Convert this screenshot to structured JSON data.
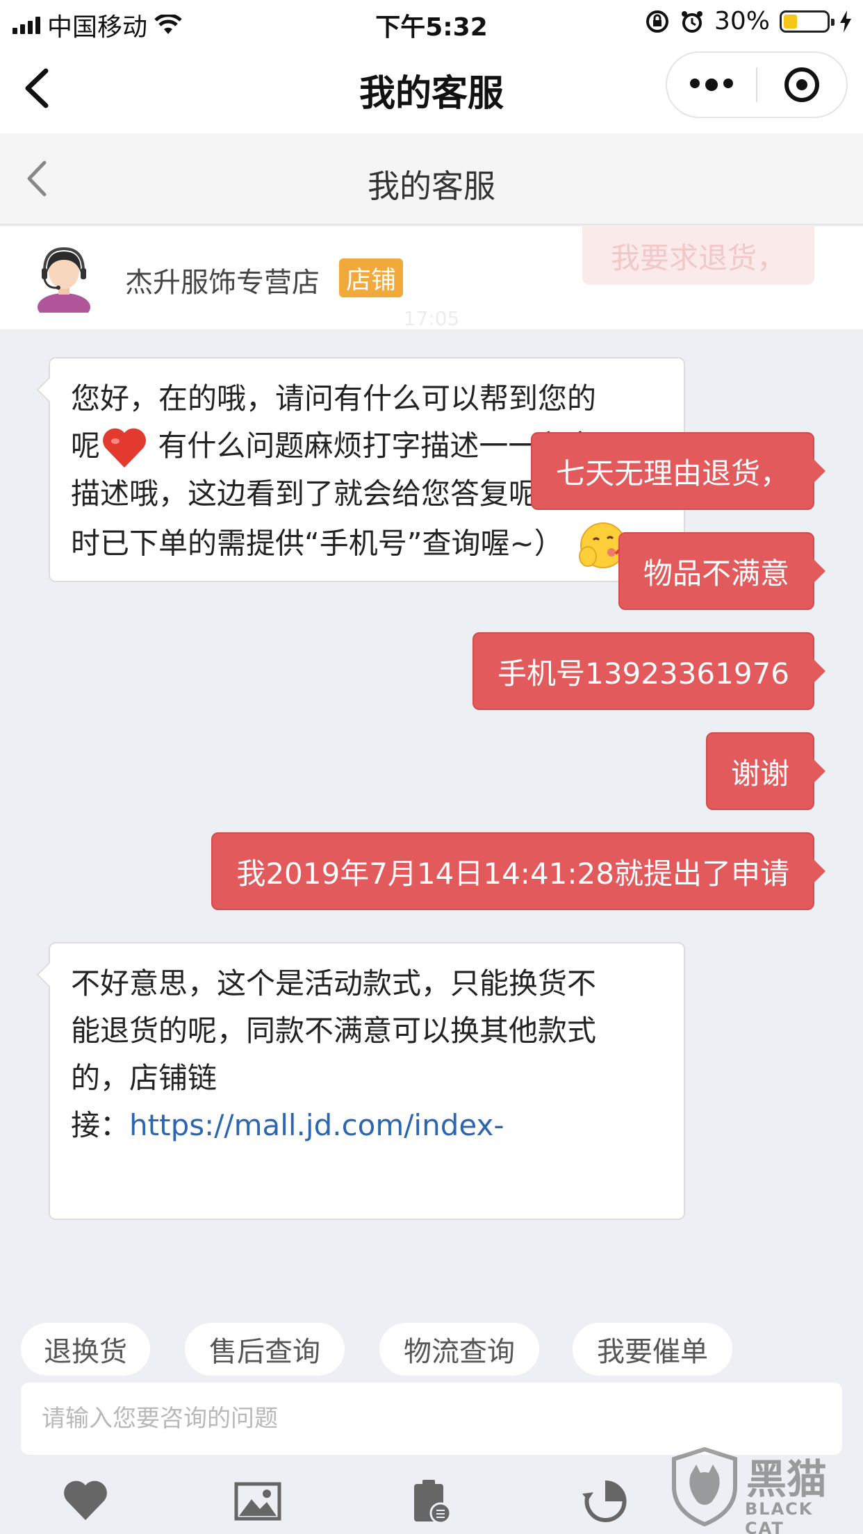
{
  "status_bar": {
    "carrier": "中国移动",
    "time": "下午5:32",
    "battery": "30%"
  },
  "nav": {
    "title": "我的客服"
  },
  "page_header": {
    "title": "我的客服"
  },
  "shop": {
    "name": "杰升服饰专营店",
    "badge": "店铺",
    "faded_message": "我要求退货，",
    "faded_time": "17:05"
  },
  "messages": [
    {
      "side": "in",
      "line1": "您好，在的哦，请问有什么可以帮到您的",
      "line2a": "呢",
      "line2b": " 有什么问题麻烦打字描述一一留言",
      "line3": "描述哦，这边看到了就会给您答复呢 （同",
      "line4": "时已下单的需提供“手机号”查询喔~）"
    },
    {
      "side": "out",
      "text": "七天无理由退货，"
    },
    {
      "side": "out",
      "text": "物品不满意"
    },
    {
      "side": "out",
      "text": "手机号13923361976"
    },
    {
      "side": "out",
      "text": "谢谢"
    },
    {
      "side": "out",
      "text": "我2019年7月14日14:41:28就提出了申请"
    },
    {
      "side": "in",
      "line1": "不好意思，这个是活动款式，只能换货不",
      "line2": "能退货的呢，同款不满意可以换其他款式",
      "line3": "的，店铺链",
      "line4_prefix": "接：",
      "link": "https://mall.jd.com/index-"
    }
  ],
  "quick_actions": [
    "退换货",
    "售后查询",
    "物流查询",
    "我要催单"
  ],
  "input": {
    "placeholder": "请输入您要咨询的问题"
  },
  "toolbar": {
    "icons": [
      "heart-icon",
      "image-icon",
      "order-icon",
      "history-icon"
    ]
  },
  "watermark": {
    "text": "黑猫",
    "sub": "BLACK CAT"
  },
  "colors": {
    "accent": "#e35a5c",
    "badge": "#f2a93b",
    "link": "#2a66b1",
    "background": "#eceff3"
  }
}
